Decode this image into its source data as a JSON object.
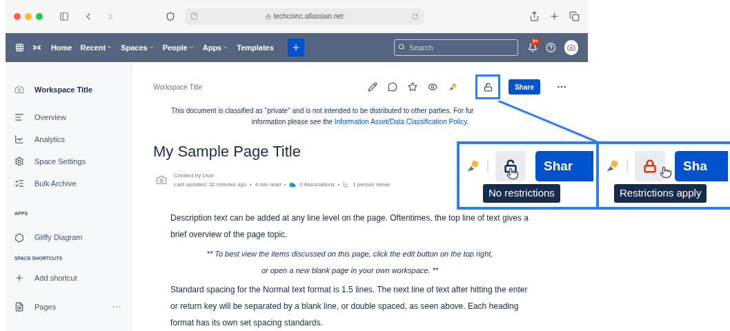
{
  "browser": {
    "url": "techcoinc.atlassian.net"
  },
  "nav": {
    "items": [
      {
        "label": "Home",
        "dropdown": false
      },
      {
        "label": "Recent",
        "dropdown": true
      },
      {
        "label": "Spaces",
        "dropdown": true
      },
      {
        "label": "People",
        "dropdown": true
      },
      {
        "label": "Apps",
        "dropdown": true
      },
      {
        "label": "Templates",
        "dropdown": false
      }
    ],
    "search_placeholder": "Search",
    "notification_badge": "9+"
  },
  "sidebar": {
    "space_title": "Workspace Title",
    "items": [
      {
        "label": "Overview",
        "kind": "overview"
      },
      {
        "label": "Analytics",
        "kind": "analytics"
      },
      {
        "label": "Space Settings",
        "kind": "settings"
      },
      {
        "label": "Bulk Archive",
        "kind": "archive"
      }
    ],
    "apps_heading": "APPS",
    "apps": [
      {
        "label": "Gliffy Diagram"
      }
    ],
    "shortcuts_heading": "SPACE SHORTCUTS",
    "add_shortcut": "Add shortcut",
    "pages": "Pages"
  },
  "page": {
    "breadcrumb": "Workspace Title",
    "share": "Share",
    "notice": {
      "line_1": "This document is classified as \"private\" and is not intended to be distributed to other parties. For fur",
      "line_2_before": "information please see the",
      "link": "Information Asset/Data Classification Policy",
      "line_2_after": "."
    },
    "title": "My Sample Page Title",
    "meta": {
      "created_by": "Created by User",
      "last_updated": "Last updated: 32 minutes ago",
      "read_time": "4 min read",
      "associations": "0 Associations",
      "viewers": "1 person viewe"
    },
    "body": [
      {
        "kind": "normal",
        "text": "Description text can be added at any line level on the page. Oftentimes, the top line of text gives a brief overview of the page topic."
      },
      {
        "kind": "note",
        "text": "** To best view the items discussed on this page, click the edit button on the top right,\nor open a new blank page in your own workspace. **"
      },
      {
        "kind": "normal",
        "text": "Standard spacing for the Normal text format is 1.5 lines. The next line of text after hitting the enter or return key will be separated by a blank line, or double spaced, as seen above. Each heading format has its own set spacing standards."
      }
    ]
  },
  "callouts": [
    {
      "restricted": false,
      "share": "Shar",
      "tooltip": "No restrictions"
    },
    {
      "restricted": true,
      "share": "Sha",
      "tooltip": "Restrictions apply"
    }
  ]
}
